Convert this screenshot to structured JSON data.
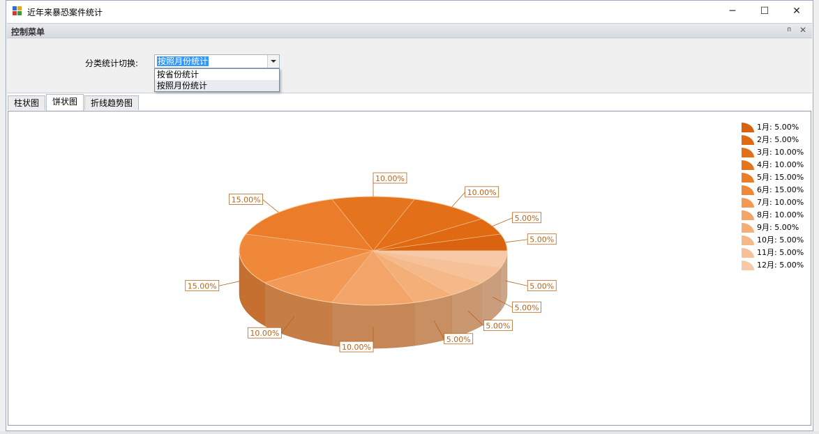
{
  "window": {
    "title": "近年来暴恐案件统计",
    "minimize_label": "─",
    "maximize_label": "☐",
    "close_label": "✕"
  },
  "panel": {
    "title": "控制菜单",
    "pin_label": "ᴨ",
    "close_label": "✕",
    "field_label": "分类统计切换:",
    "combo_value": "按照月份统计",
    "options": [
      "按省份统计",
      "按照月份统计"
    ]
  },
  "tabs": [
    {
      "label": "柱状图",
      "active": false
    },
    {
      "label": "饼状图",
      "active": true
    },
    {
      "label": "折线趋势图",
      "active": false
    }
  ],
  "colors": {
    "label_text": "#b5651d",
    "legend_text": "#000000"
  },
  "chart_data": {
    "type": "pie",
    "title": "",
    "categories": [
      "1月",
      "2月",
      "3月",
      "4月",
      "5月",
      "6月",
      "7月",
      "8月",
      "9月",
      "10月",
      "11月",
      "12月"
    ],
    "values": [
      5,
      5,
      10,
      10,
      15,
      15,
      10,
      10,
      5,
      5,
      5,
      5
    ],
    "labels": [
      "5.00%",
      "5.00%",
      "10.00%",
      "10.00%",
      "15.00%",
      "15.00%",
      "10.00%",
      "10.00%",
      "5.00%",
      "5.00%",
      "5.00%",
      "5.00%"
    ],
    "legend": [
      "1月: 5.00%",
      "2月: 5.00%",
      "3月: 10.00%",
      "4月: 10.00%",
      "5月: 15.00%",
      "6月: 15.00%",
      "7月: 10.00%",
      "8月: 10.00%",
      "9月: 5.00%",
      "10月: 5.00%",
      "11月: 5.00%",
      "12月: 5.00%"
    ],
    "colors": [
      "#d9630e",
      "#e06a12",
      "#e36f18",
      "#e5741f",
      "#eb7d2a",
      "#f0883a",
      "#f29a55",
      "#f3a468",
      "#f4ae78",
      "#f5b888",
      "#f6c198",
      "#f7c9a6"
    ],
    "legend_position": "top-right",
    "grid": false
  }
}
